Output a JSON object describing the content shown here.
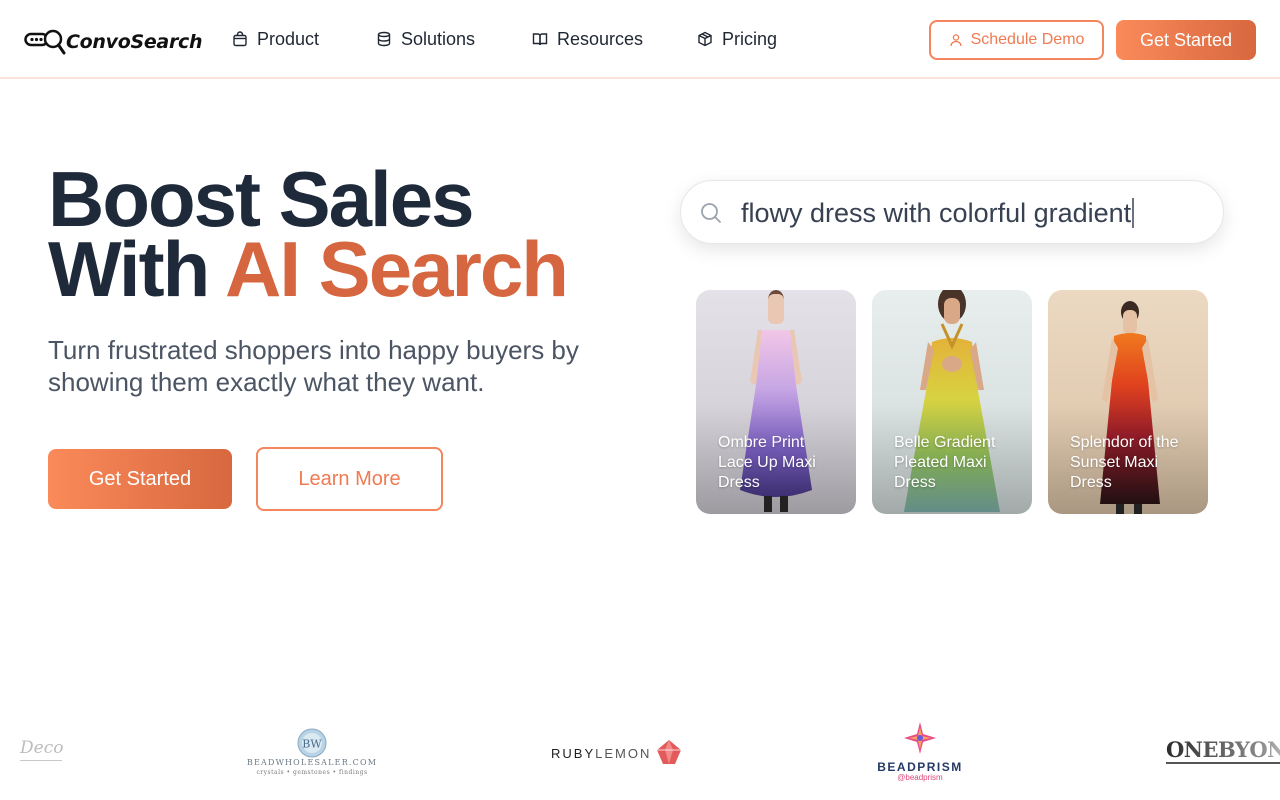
{
  "nav": {
    "logo_text": "ConvoSearch",
    "items": [
      {
        "label": "Product",
        "icon": "bag-icon"
      },
      {
        "label": "Solutions",
        "icon": "database-icon"
      },
      {
        "label": "Resources",
        "icon": "book-icon"
      },
      {
        "label": "Pricing",
        "icon": "box-icon"
      }
    ],
    "schedule_demo_label": "Schedule Demo",
    "get_started_label": "Get Started"
  },
  "hero": {
    "title_line1": "Boost Sales",
    "title_line2_plain": "With ",
    "title_line2_accent": "AI Search",
    "subtitle": "Turn frustrated shoppers into happy buyers by showing them exactly what they want.",
    "primary_button": "Get Started",
    "secondary_button": "Learn More"
  },
  "search": {
    "value": "flowy dress with colorful gradient",
    "icon": "search-icon"
  },
  "products": [
    {
      "title": "Ombre Print Lace Up Maxi Dress",
      "palette": "purple-lavender"
    },
    {
      "title": "Belle Gradient Pleated Maxi Dress",
      "palette": "yellow-green-teal"
    },
    {
      "title": "Splendor of the Sunset Maxi Dress",
      "palette": "orange-red-black"
    }
  ],
  "brands": {
    "deco": "Deco",
    "beadwholesaler_name": "BEADWHOLESALER.COM",
    "beadwholesaler_tag": "crystals • gemstones • findings",
    "beadwholesaler_badge": "BW",
    "rubylemon_bold": "RUBY",
    "rubylemon_light": "LEMON",
    "beadprism_name": "BEADPRISM",
    "beadprism_handle": "@beadprism",
    "onebyone": "ONEBYONE"
  },
  "colors": {
    "accent": "#d5663f",
    "accent_light": "#fb8a5a",
    "heading": "#1e2a3a",
    "body_text": "#4b5563"
  }
}
